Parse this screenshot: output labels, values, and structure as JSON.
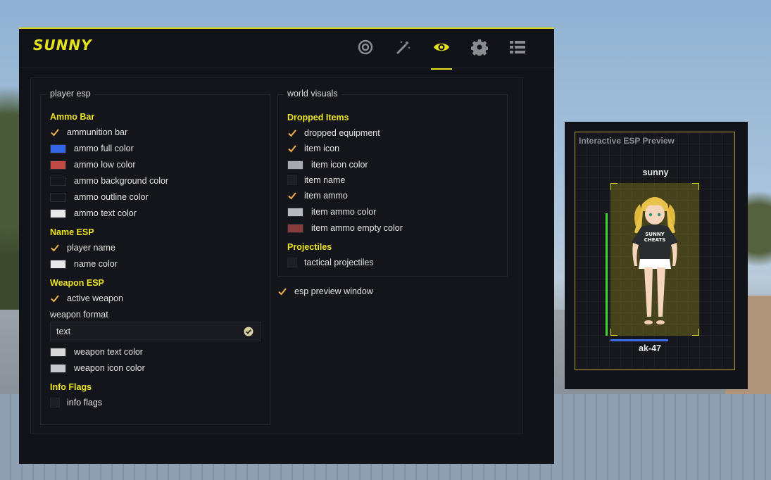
{
  "app": {
    "logo": "SUNNY"
  },
  "tabs": [
    {
      "icon": "target-icon",
      "active": false
    },
    {
      "icon": "magic-wand-icon",
      "active": false
    },
    {
      "icon": "eye-icon",
      "active": true
    },
    {
      "icon": "gear-icon",
      "active": false
    },
    {
      "icon": "list-icon",
      "active": false
    }
  ],
  "colors": {
    "accent": "#e4e21c",
    "ammo_full": "#3366e6",
    "ammo_low": "#c04a44",
    "ammo_background": "#15161b",
    "ammo_outline": "#15161b",
    "ammo_text": "#e8e8e8",
    "name": "#e8e8e8",
    "weapon_text": "#d8d8d8",
    "weapon_icon": "#c6c8cf",
    "item_icon": "#a8a9b0",
    "item_ammo": "#b8b9bf",
    "item_ammo_empty": "#8a3b3b",
    "health_bar": "#3ed62e",
    "ammo_preview_bar": "#3c6ff0"
  },
  "player_esp": {
    "title": "player esp",
    "ammo_bar_section": "Ammo Bar",
    "ammunition_bar": {
      "label": "ammunition bar",
      "checked": true
    },
    "ammo_full_color": "ammo full color",
    "ammo_low_color": "ammo low color",
    "ammo_background_color": "ammo background color",
    "ammo_outline_color": "ammo outline color",
    "ammo_text_color": "ammo text color",
    "name_esp_section": "Name ESP",
    "player_name": {
      "label": "player name",
      "checked": true
    },
    "name_color": "name color",
    "weapon_esp_section": "Weapon ESP",
    "active_weapon": {
      "label": "active weapon",
      "checked": true
    },
    "weapon_format_label": "weapon format",
    "weapon_format_value": "text",
    "weapon_text_color": "weapon text color",
    "weapon_icon_color": "weapon icon color",
    "info_flags_section": "Info Flags",
    "info_flags": {
      "label": "info flags",
      "checked": false
    }
  },
  "world_visuals": {
    "title": "world visuals",
    "dropped_items_section": "Dropped Items",
    "dropped_equipment": {
      "label": "dropped equipment",
      "checked": true
    },
    "item_icon": {
      "label": "item icon",
      "checked": true
    },
    "item_icon_color": "item icon color",
    "item_name": {
      "label": "item name",
      "checked": false
    },
    "item_ammo": {
      "label": "item ammo",
      "checked": true
    },
    "item_ammo_color": "item ammo color",
    "item_ammo_empty_color": "item ammo empty color",
    "projectiles_section": "Projectiles",
    "tactical_projectiles": {
      "label": "tactical projectiles",
      "checked": false
    }
  },
  "esp_preview_window": {
    "label": "esp preview window",
    "checked": true
  },
  "preview": {
    "title": "Interactive ESP Preview",
    "player_name": "sunny",
    "weapon": "ak-47",
    "health_fraction": 1.0,
    "ammo_fraction": 0.65
  }
}
